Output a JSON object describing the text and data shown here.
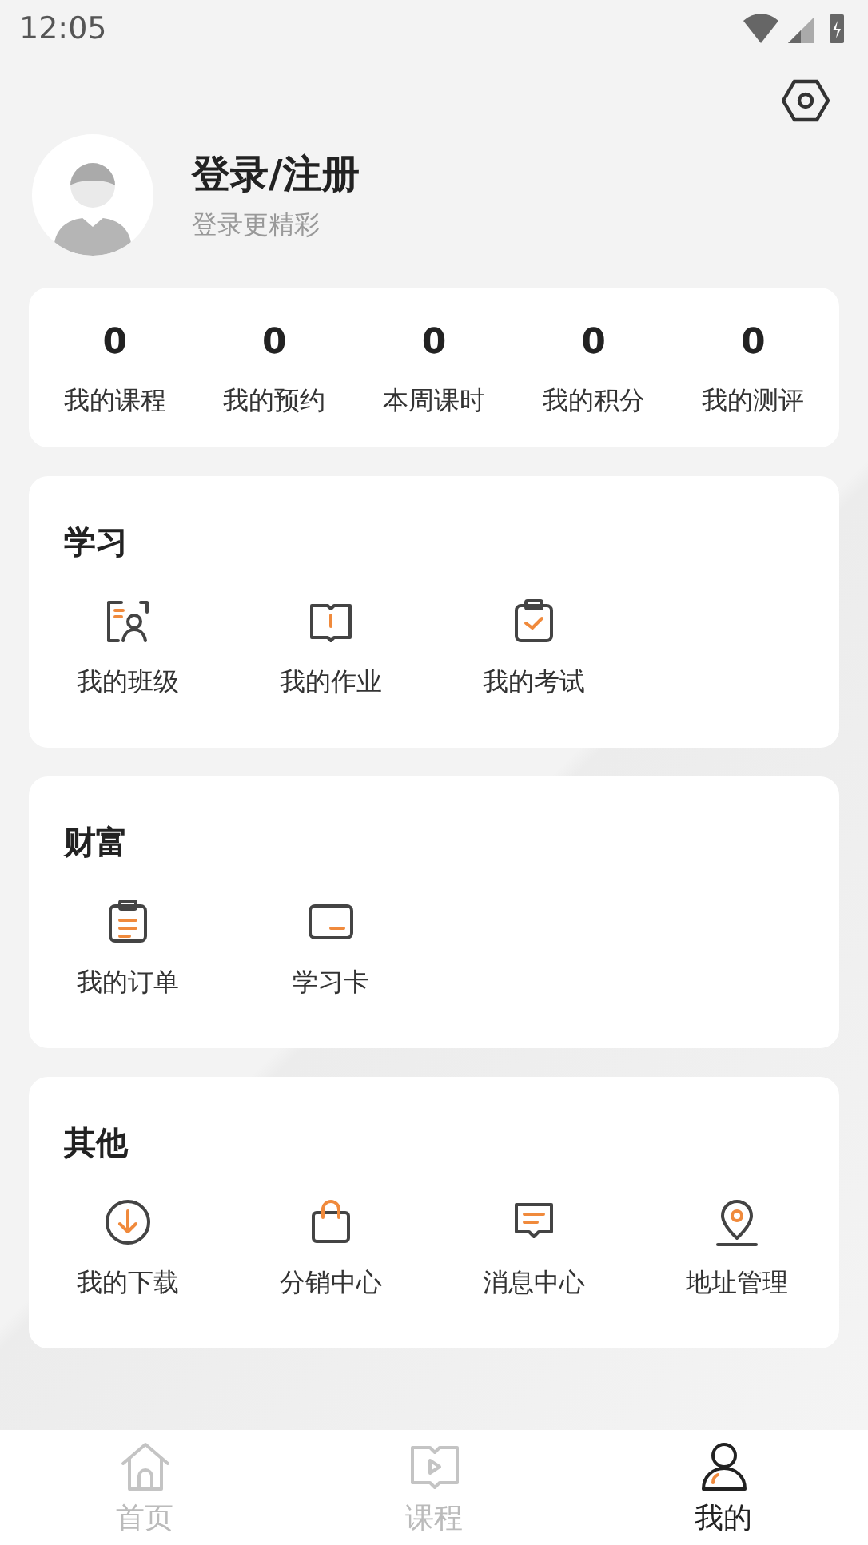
{
  "status_bar": {
    "time": "12:05"
  },
  "profile": {
    "title": "登录/注册",
    "subtitle": "登录更精彩"
  },
  "stats": [
    {
      "value": "0",
      "label": "我的课程"
    },
    {
      "value": "0",
      "label": "我的预约"
    },
    {
      "value": "0",
      "label": "本周课时"
    },
    {
      "value": "0",
      "label": "我的积分"
    },
    {
      "value": "0",
      "label": "我的测评"
    }
  ],
  "sections": [
    {
      "title": "学习",
      "items": [
        "我的班级",
        "我的作业",
        "我的考试"
      ]
    },
    {
      "title": "财富",
      "items": [
        "我的订单",
        "学习卡"
      ]
    },
    {
      "title": "其他",
      "items": [
        "我的下载",
        "分销中心",
        "消息中心",
        "地址管理"
      ]
    }
  ],
  "tabs": [
    {
      "label": "首页",
      "selected": false
    },
    {
      "label": "课程",
      "selected": false
    },
    {
      "label": "我的",
      "selected": true
    }
  ]
}
